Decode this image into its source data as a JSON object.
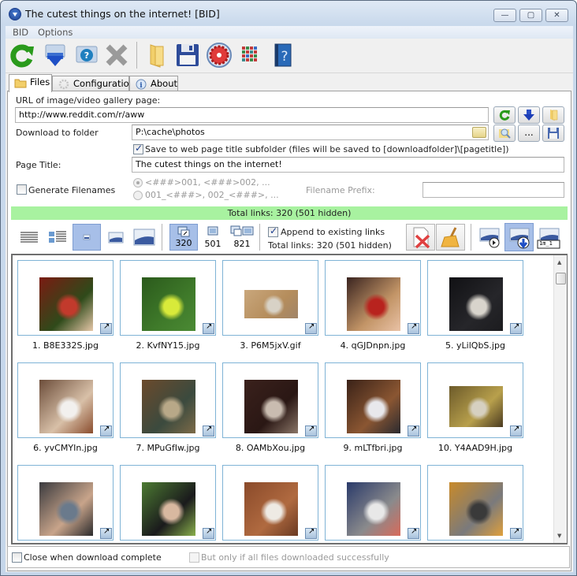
{
  "window": {
    "title": "The cutest things on the internet! [BID]",
    "controls": {
      "minimize": "—",
      "maximize": "▢",
      "close": "✕"
    }
  },
  "menu": [
    "BID",
    "Options"
  ],
  "toolbar": {
    "buttons": [
      "refresh-icon",
      "download-icon",
      "help-icon",
      "cancel-icon",
      "folder-icon",
      "save-icon",
      "settings-icon",
      "color-grid-icon",
      "help-book-icon"
    ]
  },
  "tabs": [
    {
      "label": "Files",
      "icon": "folder-icon",
      "active": true
    },
    {
      "label": "Configuration",
      "icon": "gear-icon",
      "active": false
    },
    {
      "label": "About",
      "icon": "info-icon",
      "active": false
    }
  ],
  "form": {
    "url_label": "URL of image/video gallery page:",
    "url_value": "http://www.reddit.com/r/aww",
    "folder_label": "Download to folder",
    "folder_value": "P:\\cache\\photos",
    "save_subfolder_label": "Save to web page title subfolder (files will be saved to [downloadfolder]\\[pagetitle])",
    "save_subfolder_checked": true,
    "page_title_label": "Page Title:",
    "page_title_value": "The cutest things on the internet!",
    "generate_filenames_label": "Generate Filenames",
    "generate_filenames_checked": false,
    "radio_option_1": "<###>001, <###>002, ...",
    "radio_option_2": "001_<###>, 002_<###>, ...",
    "filename_prefix_label": "Filename Prefix:",
    "filename_prefix_value": "",
    "ellipsis_button": "..."
  },
  "status_bar": "Total links: 320 (501 hidden)",
  "view": {
    "counts": [
      "320",
      "501",
      "821"
    ],
    "append_label": "Append to existing links",
    "append_checked": true,
    "total_links": "Total links: 320 (501 hidden)",
    "rename_label": "1m_1"
  },
  "files": [
    {
      "name": "1. B8E332S.jpg",
      "colors": [
        "#7a1b12",
        "#2f4a1a",
        "#c23a2c",
        "#e6c7a8"
      ]
    },
    {
      "name": "2. KvfNY15.jpg",
      "colors": [
        "#2b5a1c",
        "#3f7a2a",
        "#d8ea3a",
        "#4b8a34"
      ]
    },
    {
      "name": "3. P6M5jxV.gif",
      "colors": [
        "#c9a77c",
        "#b58d5c",
        "#d8d2c6",
        "#a08468"
      ]
    },
    {
      "name": "4. qGJDnpn.jpg",
      "colors": [
        "#3a2420",
        "#c29466",
        "#b8231e",
        "#e9c2a6"
      ]
    },
    {
      "name": "5. yLilQbS.jpg",
      "colors": [
        "#111114",
        "#26262a",
        "#d8d4cc",
        "#1c1c1f"
      ]
    },
    {
      "name": "6. yvCMYIn.jpg",
      "colors": [
        "#6c4d3a",
        "#d8c0a8",
        "#f2f0ee",
        "#8a4d2e"
      ]
    },
    {
      "name": "7. MPuGfIw.jpg",
      "colors": [
        "#6b4a2c",
        "#3b4a3e",
        "#b8a888",
        "#7c6a48"
      ]
    },
    {
      "name": "8. OAMbXou.jpg",
      "colors": [
        "#3a211c",
        "#2a1714",
        "#c9bcb0",
        "#8a7668"
      ]
    },
    {
      "name": "9. mLTfbri.jpg",
      "colors": [
        "#3a2218",
        "#8a5632",
        "#e8e8ec",
        "#2a2a30"
      ]
    },
    {
      "name": "10. Y4AAD9H.jpg",
      "colors": [
        "#6c5a2a",
        "#b8a04c",
        "#d6d0c0",
        "#4a3a20"
      ]
    },
    {
      "name": "",
      "colors": [
        "#3a3a3e",
        "#c8a48a",
        "#6a7a8c",
        "#2a2a2c"
      ]
    },
    {
      "name": "",
      "colors": [
        "#4c7a32",
        "#1a1a1c",
        "#d8b8a0",
        "#8ab04c"
      ]
    },
    {
      "name": "",
      "colors": [
        "#8a4a2a",
        "#b06a40",
        "#eeeae4",
        "#6a3a22"
      ]
    },
    {
      "name": "",
      "colors": [
        "#2a3a6a",
        "#8a8a8c",
        "#e8e8e8",
        "#d86a5a"
      ]
    },
    {
      "name": "",
      "colors": [
        "#c88a2a",
        "#7a7a7c",
        "#3a3a3a",
        "#e0a03c"
      ]
    }
  ],
  "bottom": {
    "close_label": "Close when download complete",
    "close_checked": false,
    "only_if_label": "But only if all files downloaded successfully",
    "only_if_checked": false
  },
  "colors": {
    "status_green": "#a8f2a0",
    "selected_view": "#a7bfe8",
    "cell_border": "#7fb3d6"
  }
}
